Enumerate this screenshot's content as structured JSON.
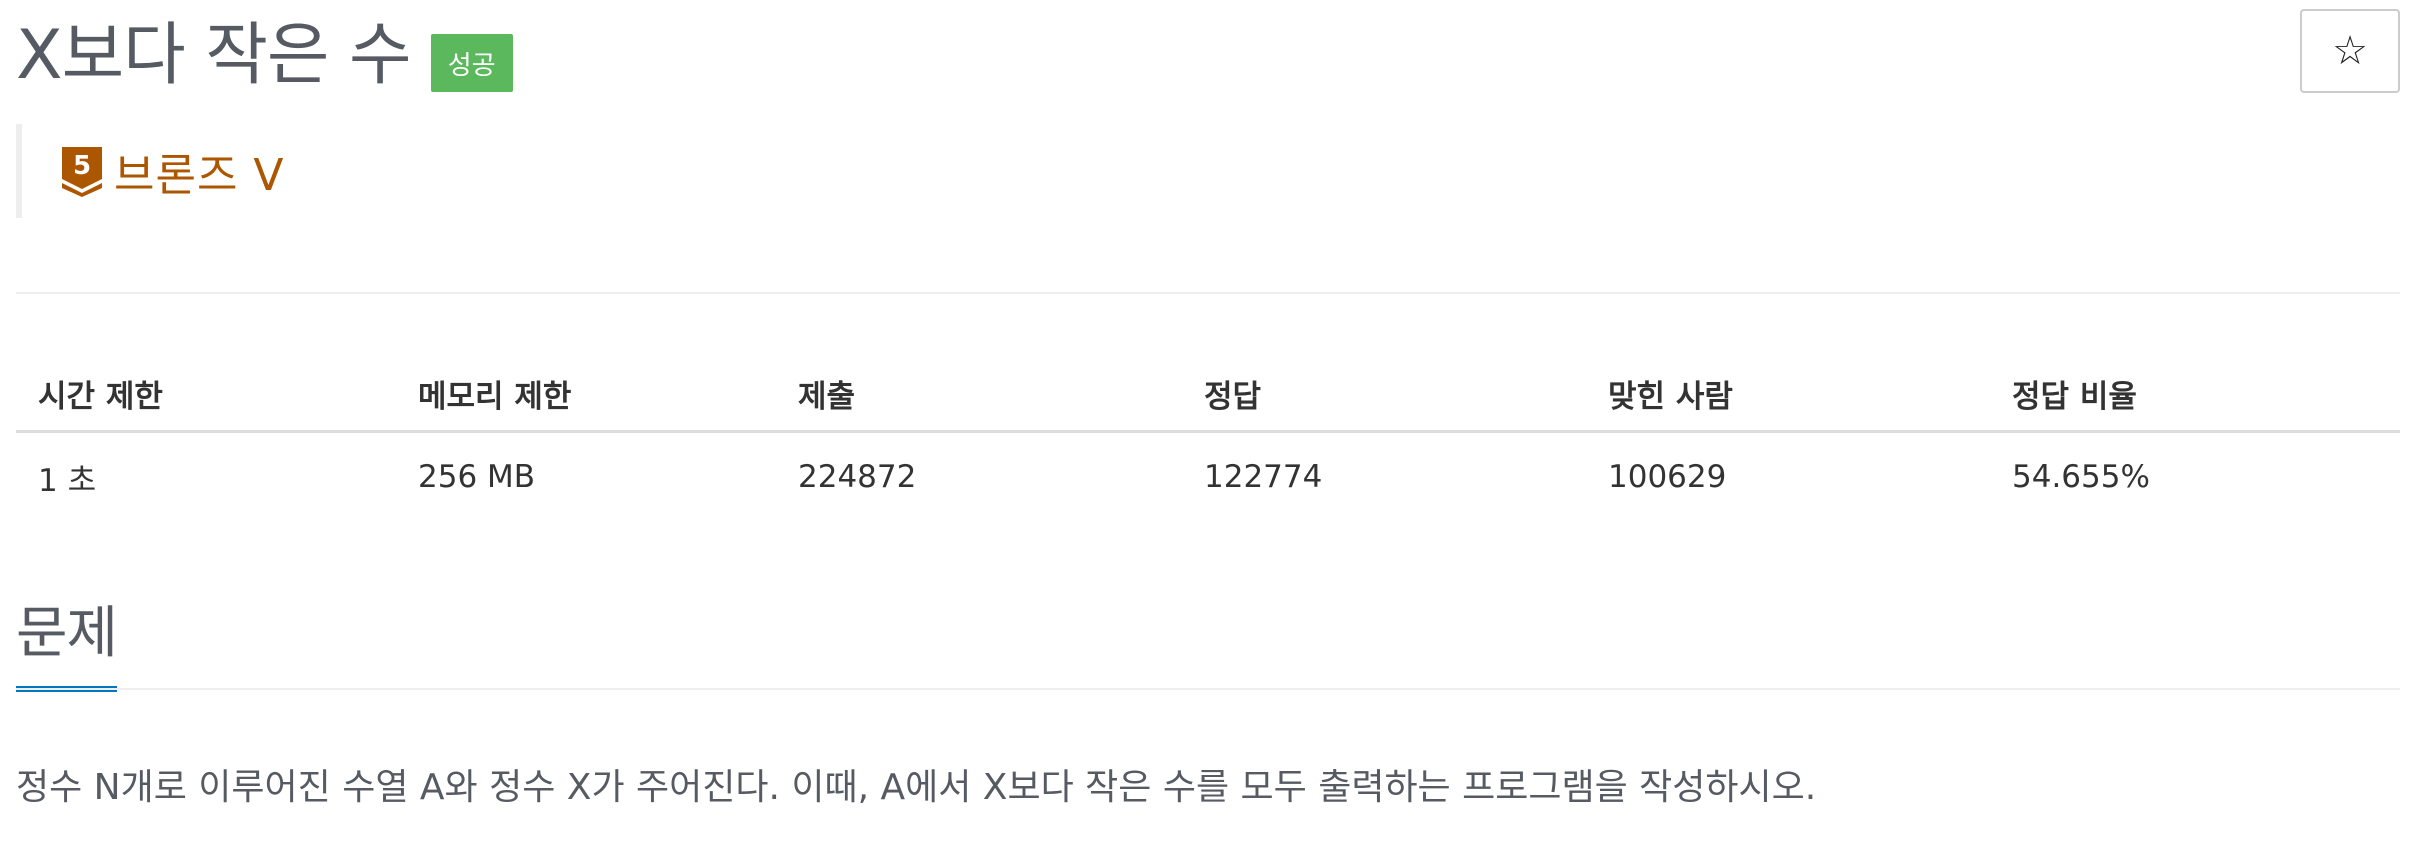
{
  "problem": {
    "title": "X보다 작은 수",
    "result_badge": "성공",
    "star_symbol": "☆"
  },
  "tier": {
    "level_number": "5",
    "label": "브론즈 V",
    "color": "#ad5600"
  },
  "info_table": {
    "headers": [
      "시간 제한",
      "메모리 제한",
      "제출",
      "정답",
      "맞힌 사람",
      "정답 비율"
    ],
    "values": [
      "1 초",
      "256 MB",
      "224872",
      "122774",
      "100629",
      "54.655%"
    ]
  },
  "section": {
    "title": "문제",
    "description": "정수 N개로 이루어진 수열 A와 정수 X가 주어진다. 이때, A에서 X보다 작은 수를 모두 출력하는 프로그램을 작성하시오."
  },
  "colors": {
    "success_badge": "#5cb85c",
    "section_accent": "#0076c0",
    "title_text": "#555a63"
  }
}
